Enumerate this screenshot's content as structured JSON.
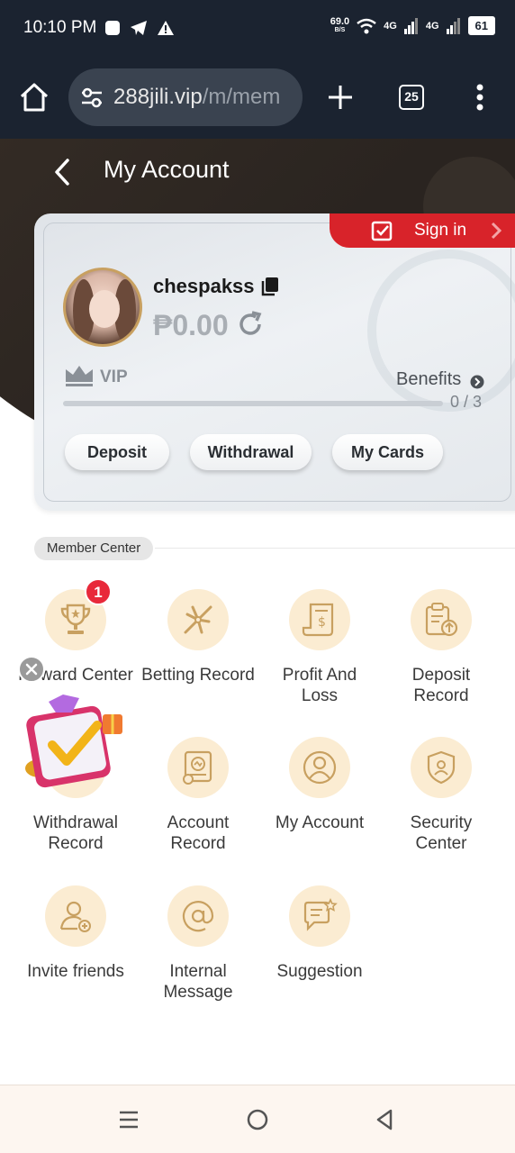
{
  "status_bar": {
    "time": "10:10 PM",
    "speed": "69.0",
    "speed_unit": "B/S",
    "network_1": "4G",
    "network_2": "4G",
    "battery": "61"
  },
  "browser": {
    "url_main": "288jili.vip",
    "url_path": "/m/mem",
    "tab_count": "25"
  },
  "header": {
    "title": "My Account"
  },
  "account_card": {
    "sign_in_label": "Sign in",
    "username": "chespakss",
    "balance": "₱0.00",
    "vip_label": "VIP",
    "benefits_label": "Benefits",
    "progress_text": "0 / 3",
    "progress_fraction": 0,
    "buttons": {
      "deposit": "Deposit",
      "withdrawal": "Withdrawal",
      "my_cards": "My Cards"
    }
  },
  "member_center": {
    "label": "Member Center",
    "reward_badge": "1",
    "items": [
      {
        "label": "Reward Center",
        "icon": "trophy-icon"
      },
      {
        "label": "Betting Record",
        "icon": "betting-icon"
      },
      {
        "label": "Profit And\nLoss",
        "icon": "receipt-dollar-icon"
      },
      {
        "label": "Deposit\nRecord",
        "icon": "clipboard-upload-icon"
      },
      {
        "label": "Withdrawal\nRecord",
        "icon": "withdrawal-icon"
      },
      {
        "label": "Account\nRecord",
        "icon": "chart-record-icon"
      },
      {
        "label": "My Account",
        "icon": "user-circle-icon"
      },
      {
        "label": "Security\nCenter",
        "icon": "shield-user-icon"
      },
      {
        "label": "Invite friends",
        "icon": "user-add-icon"
      },
      {
        "label": "Internal\nMessage",
        "icon": "at-sign-icon"
      },
      {
        "label": "Suggestion",
        "icon": "chat-star-icon"
      }
    ]
  },
  "colors": {
    "accent_gold": "#c8a060",
    "icon_bg": "#fbecd2",
    "sign_in_red": "#d8232a",
    "status_bar": "#1b2330"
  }
}
